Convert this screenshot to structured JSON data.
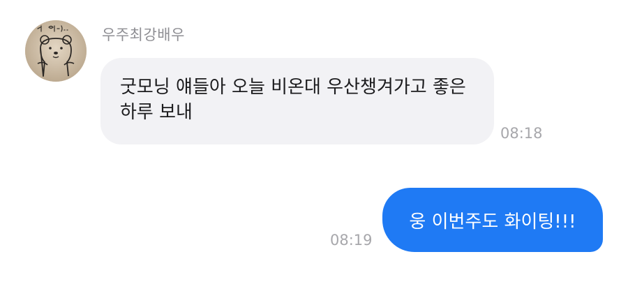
{
  "conversation": {
    "incoming": {
      "sender_name": "우주최강배우",
      "avatar": {
        "icon": "bear-sketch-icon",
        "handwriting": "나 안아..",
        "background_color": "#d8c8b2"
      },
      "message": "굿모닝 얘들아 오늘 비온대 우산챙겨가고 좋은 하루 보내",
      "time": "08:18",
      "bubble_color": "#f2f2f5"
    },
    "outgoing": {
      "message": "웅 이번주도 화이팅!!!",
      "time": "08:19",
      "bubble_color": "#1f7af4"
    }
  }
}
